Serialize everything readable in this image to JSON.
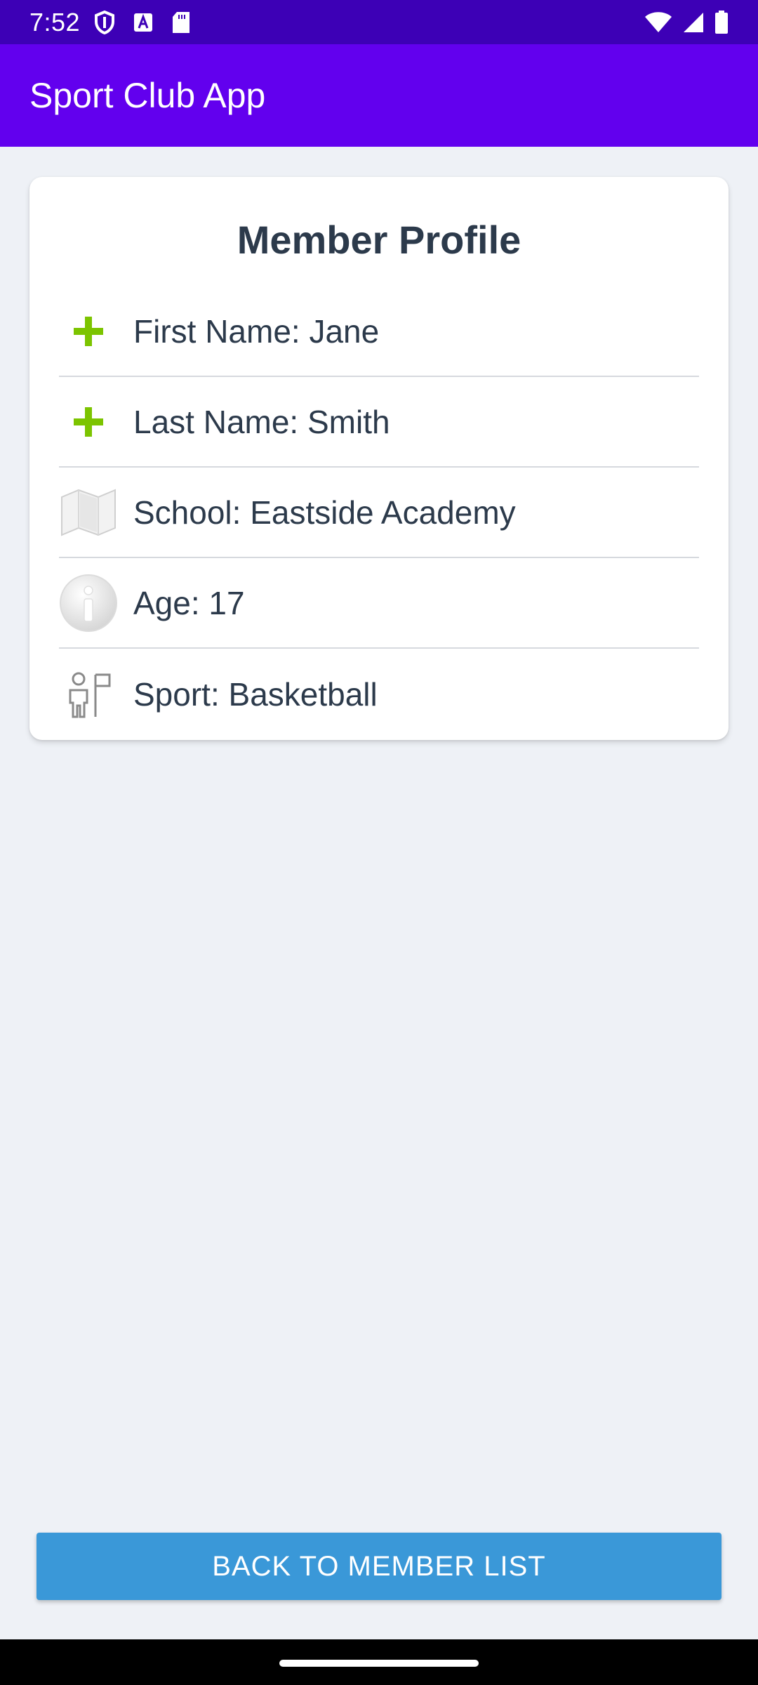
{
  "status_bar": {
    "time": "7:52",
    "left_icons": [
      "shield-icon",
      "font-a-icon",
      "sd-card-icon"
    ],
    "right_icons": [
      "wifi-icon",
      "signal-icon",
      "battery-icon"
    ]
  },
  "app_bar": {
    "title": "Sport Club App",
    "color": "#6200ee"
  },
  "profile": {
    "title": "Member Profile",
    "rows": [
      {
        "icon": "plus-icon",
        "text": "First Name: Jane"
      },
      {
        "icon": "plus-icon",
        "text": "Last Name: Smith"
      },
      {
        "icon": "map-icon",
        "text": "School: Eastside Academy"
      },
      {
        "icon": "info-icon",
        "text": "Age: 17"
      },
      {
        "icon": "person-flag-icon",
        "text": "Sport: Basketball"
      }
    ]
  },
  "back_button": {
    "label": "BACK TO MEMBER LIST",
    "color": "#3a98d8"
  }
}
